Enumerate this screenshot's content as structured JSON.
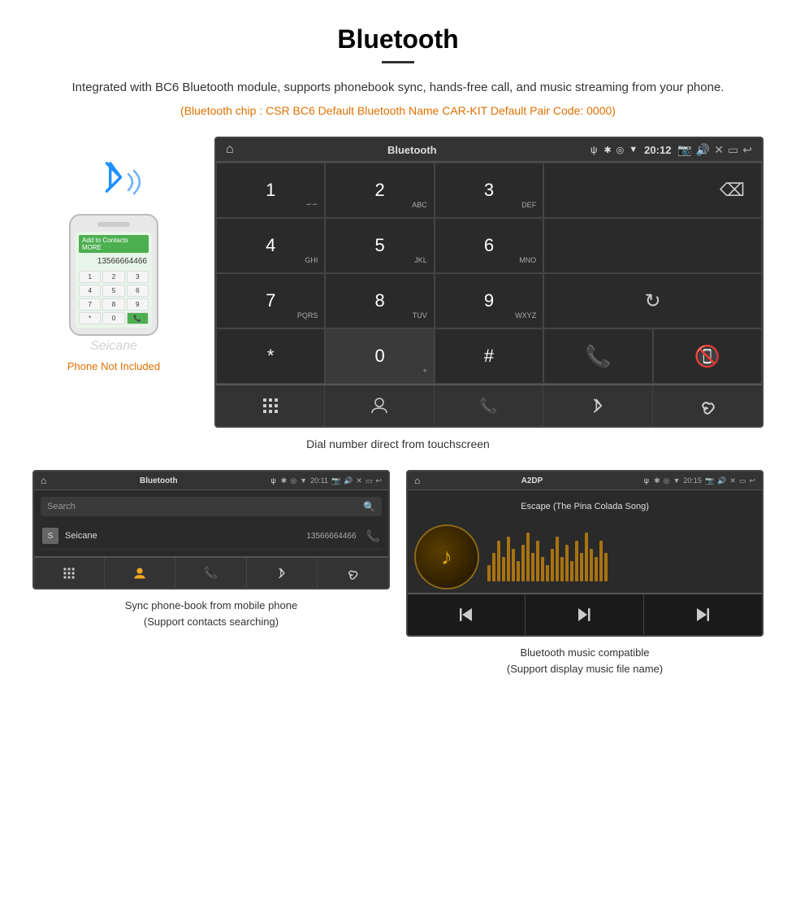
{
  "page": {
    "title": "Bluetooth",
    "description": "Integrated with BC6 Bluetooth module, supports phonebook sync, hands-free call, and music streaming from your phone.",
    "specs": "(Bluetooth chip : CSR BC6    Default Bluetooth Name CAR-KIT    Default Pair Code: 0000)",
    "dial_caption": "Dial number direct from touchscreen",
    "panel1_caption": "Sync phone-book from mobile phone\n(Support contacts searching)",
    "panel2_caption": "Bluetooth music compatible\n(Support display music file name)"
  },
  "car_screen": {
    "status_title": "Bluetooth",
    "status_usb": "ψ",
    "status_time": "20:12"
  },
  "phonebook_screen": {
    "status_title": "Bluetooth",
    "status_time": "20:11",
    "search_placeholder": "Search",
    "contacts": [
      {
        "letter": "S",
        "name": "Seicane",
        "number": "13566664466"
      }
    ]
  },
  "music_screen": {
    "status_title": "A2DP",
    "status_time": "20:15",
    "song_title": "Escape (The Pina Colada Song)"
  },
  "phone_not_included": "Phone Not Included",
  "waveform_heights": [
    20,
    35,
    50,
    30,
    55,
    40,
    25,
    45,
    60,
    35,
    50,
    30,
    20,
    40,
    55,
    30,
    45,
    25,
    50,
    35,
    60,
    40,
    30,
    50,
    35
  ],
  "dialpad": {
    "keys": [
      {
        "main": "1",
        "sub": "∽∽"
      },
      {
        "main": "2",
        "sub": "ABC"
      },
      {
        "main": "3",
        "sub": "DEF"
      },
      {
        "main": "4",
        "sub": "GHI"
      },
      {
        "main": "5",
        "sub": "JKL"
      },
      {
        "main": "6",
        "sub": "MNO"
      },
      {
        "main": "7",
        "sub": "PQRS"
      },
      {
        "main": "8",
        "sub": "TUV"
      },
      {
        "main": "9",
        "sub": "WXYZ"
      },
      {
        "main": "*",
        "sub": ""
      },
      {
        "main": "0",
        "sub": "+"
      },
      {
        "main": "#",
        "sub": ""
      }
    ]
  }
}
